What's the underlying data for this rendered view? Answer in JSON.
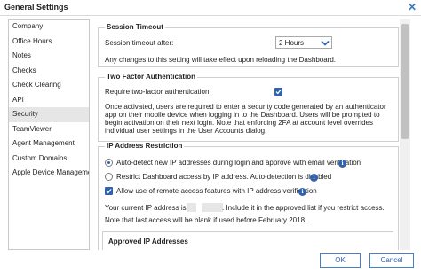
{
  "window": {
    "title": "General Settings",
    "close_glyph": "✕"
  },
  "sidebar": {
    "items": [
      {
        "label": "Company"
      },
      {
        "label": "Office Hours"
      },
      {
        "label": "Notes"
      },
      {
        "label": "Checks"
      },
      {
        "label": "Check Clearing"
      },
      {
        "label": "API"
      },
      {
        "label": "Security",
        "selected": true
      },
      {
        "label": "TeamViewer"
      },
      {
        "label": "Agent Management"
      },
      {
        "label": "Custom Domains"
      },
      {
        "label": "Apple Device Management"
      }
    ]
  },
  "session_timeout": {
    "heading": "Session Timeout",
    "label": "Session timeout after:",
    "value": "2 Hours",
    "note": "Any changes to this setting will take effect upon reloading the Dashboard."
  },
  "two_factor": {
    "heading": "Two Factor Authentication",
    "label": "Require two-factor authentication:",
    "checked": true,
    "description": "Once activated, users are required to enter a security code generated by an authenticator app on their mobile device when logging in to the Dashboard. Users will be prompted to begin activation on their next login. Note that enforcing 2FA at account level overrides individual user settings in the User Accounts dialog."
  },
  "ip_restriction": {
    "heading": "IP Address Restriction",
    "option_auto": "Auto-detect new IP addresses during login and approve with email verification",
    "option_restrict": "Restrict Dashboard access by IP address. Auto-detection is disabled",
    "remote_access": "Allow use of remote access features with IP address verification",
    "your_ip_prefix": "Your current IP address is",
    "your_ip_suffix": ". Include it in the approved list if you restrict access.",
    "last_access_note": "Note that last access will be blank if used before February 2018.",
    "approved_heading": "Approved IP Addresses"
  },
  "buttons": {
    "ok": "OK",
    "cancel": "Cancel"
  },
  "colors": {
    "accent": "#2f63b0",
    "link_border": "#4a7ec4",
    "selected_bg": "#e6e6e6"
  }
}
